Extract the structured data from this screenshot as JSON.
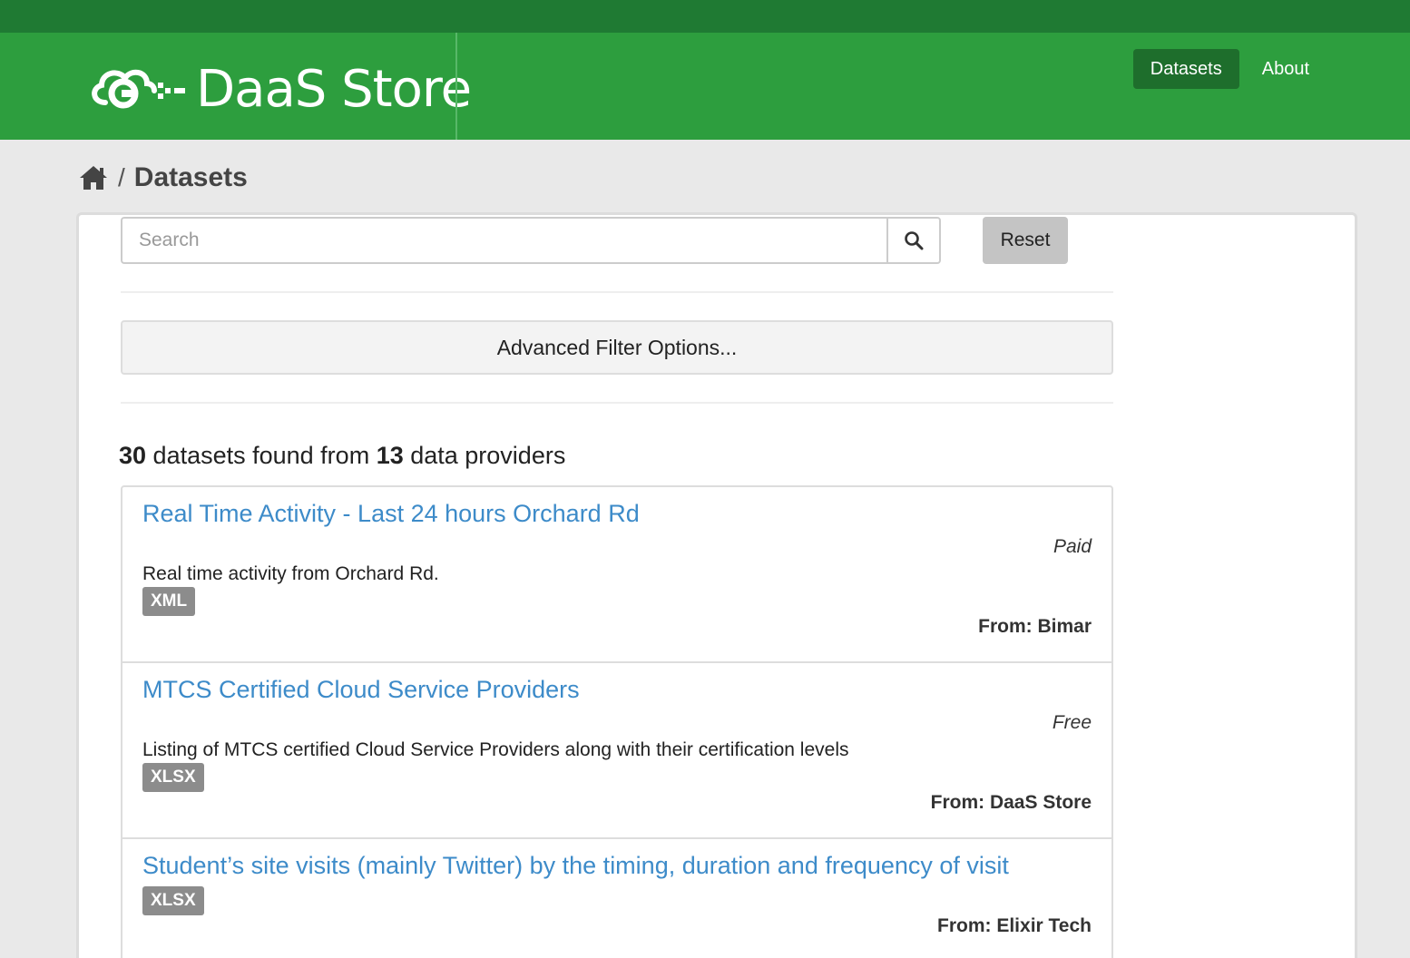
{
  "header": {
    "brand": "DaaS Store",
    "nav": [
      {
        "label": "Datasets",
        "active": true
      },
      {
        "label": "About",
        "active": false
      }
    ],
    "colors": {
      "top_strip": "#1f7a33",
      "bar": "#2d9e3e",
      "active_nav": "#1e6e2c"
    }
  },
  "breadcrumb": {
    "home_icon": "home-icon",
    "separator": "/",
    "current": "Datasets"
  },
  "search": {
    "placeholder": "Search",
    "value": "",
    "button_icon": "search-icon",
    "reset_label": "Reset"
  },
  "advanced_filter_label": "Advanced Filter Options...",
  "summary": {
    "count": "30",
    "text_middle": " datasets found from ",
    "providers": "13",
    "text_end": " data providers"
  },
  "datasets": [
    {
      "title": "Real Time Activity - Last 24 hours Orchard Rd",
      "price": "Paid",
      "description": "Real time activity from Orchard Rd.",
      "format": "XML",
      "from": "From: Bimar"
    },
    {
      "title": "MTCS Certified Cloud Service Providers",
      "price": "Free",
      "description": "Listing of MTCS certified Cloud Service Providers along with their certification levels",
      "format": "XLSX",
      "from": "From: DaaS Store"
    },
    {
      "title": "Student’s site visits (mainly Twitter) by the timing, duration and frequency of visit",
      "format": "XLSX",
      "from": "From: Elixir Tech"
    }
  ],
  "colors": {
    "link": "#3d8bc9",
    "badge": "#8c8c8c",
    "page_bg": "#e9e9e9"
  }
}
